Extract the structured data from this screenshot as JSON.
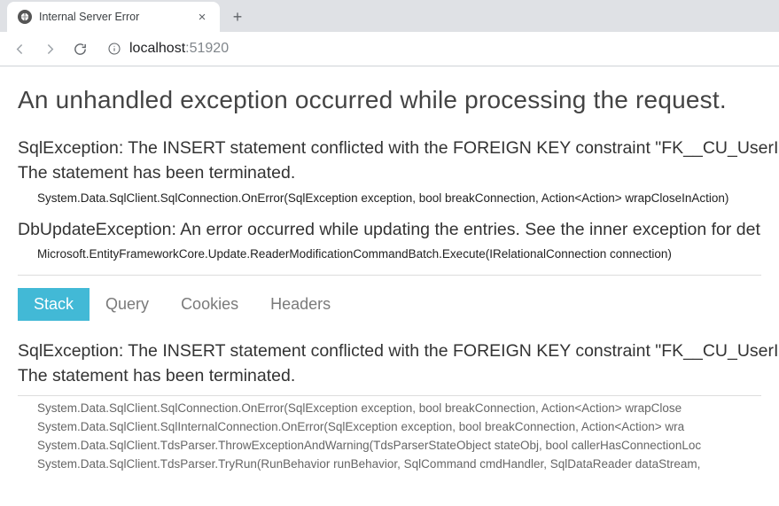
{
  "browser": {
    "tab_title": "Internal Server Error",
    "new_tab_glyph": "+",
    "close_glyph": "×",
    "url_host": "localhost",
    "url_port": ":51920"
  },
  "page_heading": "An unhandled exception occurred while processing the request.",
  "summary": [
    {
      "heading_line1": "SqlException: The INSERT statement conflicted with the FOREIGN KEY constraint \"FK__CU_UserIn__",
      "heading_line2": "The statement has been terminated.",
      "trace": "System.Data.SqlClient.SqlConnection.OnError(SqlException exception, bool breakConnection, Action<Action> wrapCloseInAction)"
    },
    {
      "heading_line1": "DbUpdateException: An error occurred while updating the entries. See the inner exception for det",
      "heading_line2": "",
      "trace": "Microsoft.EntityFrameworkCore.Update.ReaderModificationCommandBatch.Execute(IRelationalConnection connection)"
    }
  ],
  "tabs": {
    "items": [
      "Stack",
      "Query",
      "Cookies",
      "Headers"
    ],
    "selected_index": 0
  },
  "stack": {
    "heading_line1": "SqlException: The INSERT statement conflicted with the FOREIGN KEY constraint \"FK__CU_UserIn_",
    "heading_line2": "The statement has been terminated.",
    "lines": [
      "System.Data.SqlClient.SqlConnection.OnError(SqlException exception, bool breakConnection, Action<Action> wrapClose",
      "System.Data.SqlClient.SqlInternalConnection.OnError(SqlException exception, bool breakConnection, Action<Action> wra",
      "System.Data.SqlClient.TdsParser.ThrowExceptionAndWarning(TdsParserStateObject stateObj, bool callerHasConnectionLoc",
      "System.Data.SqlClient.TdsParser.TryRun(RunBehavior runBehavior, SqlCommand cmdHandler, SqlDataReader dataStream,"
    ]
  }
}
